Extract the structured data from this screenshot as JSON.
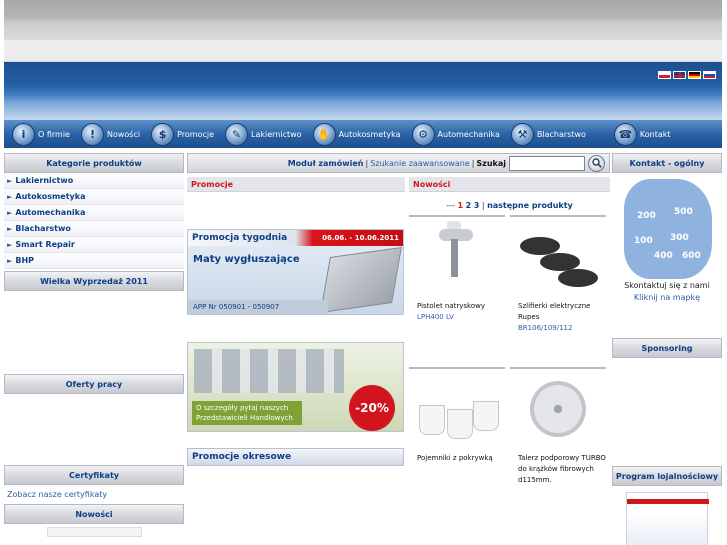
{
  "nav": {
    "items": [
      {
        "label": "O firmie",
        "icon": "info-icon"
      },
      {
        "label": "Nowości",
        "icon": "exclamation-icon"
      },
      {
        "label": "Promocje",
        "icon": "dollar-icon"
      },
      {
        "label": "Lakiernictwo",
        "icon": "spray-icon"
      },
      {
        "label": "Autokosmetyka",
        "icon": "hand-icon"
      },
      {
        "label": "Automechanika",
        "icon": "wrench-icon"
      },
      {
        "label": "Blacharstwo",
        "icon": "hammer-icon"
      },
      {
        "label": "Kontakt",
        "icon": "phone-icon"
      }
    ]
  },
  "sidebar": {
    "categories_title": "Kategorie produktów",
    "categories": [
      "Lakiernictwo",
      "Autokosmetyka",
      "Automechanika",
      "Blacharstwo",
      "Smart Repair",
      "BHP"
    ],
    "sale_title": "Wielka Wyprzedaż 2011",
    "jobs_title": "Oferty pracy",
    "certificates_title": "Certyfikaty",
    "certificates_link": "Zobacz nasze certyfikaty",
    "news_title": "Nowości"
  },
  "toolbar": {
    "order_module": "Moduł zamówień",
    "advanced_search": "Szukanie zaawansowane",
    "search_label": "Szukaj",
    "search_value": ""
  },
  "promo": {
    "section_title": "Promocje",
    "week_title": "Promocja tygodnia",
    "week_dates": "06.06. - 10.06.2011",
    "week_product": "Maty wygłuszające",
    "week_code": "APP Nr 050901 - 050907",
    "discount": "-20%",
    "discount_text": "O szczegóły pytaj naszych Przedstawicieli Handlowych",
    "periodic_title": "Promocje okresowe"
  },
  "news": {
    "section_title": "Nowości",
    "pager_prefix": "---",
    "pages": [
      "1",
      "2",
      "3"
    ],
    "next_label": "następne produkty",
    "products": [
      {
        "title": "Pistolet natryskowy",
        "code": "LPH400 LV"
      },
      {
        "title": "Szlifierki elektryczne Rupes",
        "code": "BR106/109/112"
      },
      {
        "title": "Pojemniki z pokrywką",
        "code": ""
      },
      {
        "title": "Talerz podporowy TURBO do krążków fibrowych d115mm.",
        "code": ""
      }
    ]
  },
  "contact": {
    "title": "Kontakt - ogólny",
    "regions": [
      "200",
      "500",
      "100",
      "300",
      "400",
      "600"
    ],
    "text": "Skontaktuj się z nami",
    "link": "Kliknij na mapkę",
    "sponsoring_title": "Sponsoring",
    "loyalty_title": "Program lojalnościowy"
  }
}
